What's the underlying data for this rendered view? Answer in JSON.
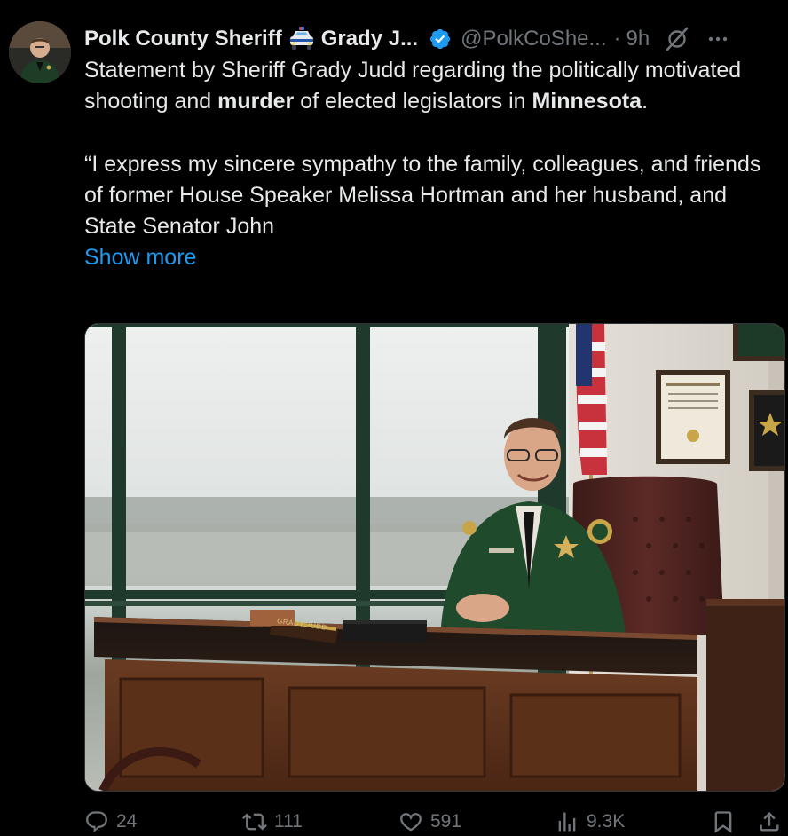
{
  "author": {
    "display_name": "Polk County Sheriff",
    "name_suffix": "Grady J...",
    "handle": "@PolkCoShe...",
    "separator": "·",
    "time": "9h",
    "verified": true,
    "icons": [
      "police-car-emoji-icon",
      "verified-badge-icon",
      "grok-icon",
      "more-options-icon"
    ]
  },
  "tweet": {
    "line1_before": "Statement by Sheriff Grady Judd regarding the politically motivated shooting and ",
    "bold1": "murder",
    "line1_after": " of elected legislators in ",
    "bold2": "Minnesota",
    "line1_end": ".",
    "quote": "“I express my sincere sympathy to the family, colleagues, and friends of former House Speaker Melissa Hortman and her husband, and State Senator John",
    "show_more": "Show more"
  },
  "media": {
    "nameplate_text": "GRADY JUDD"
  },
  "actions": {
    "replies": "24",
    "reposts": "111",
    "likes": "591",
    "views": "9.3K"
  },
  "colors": {
    "background": "#000000",
    "text": "#e7e9ea",
    "secondary": "#71767b",
    "link": "#1d9bf0",
    "verified": "#1d9bf0"
  }
}
